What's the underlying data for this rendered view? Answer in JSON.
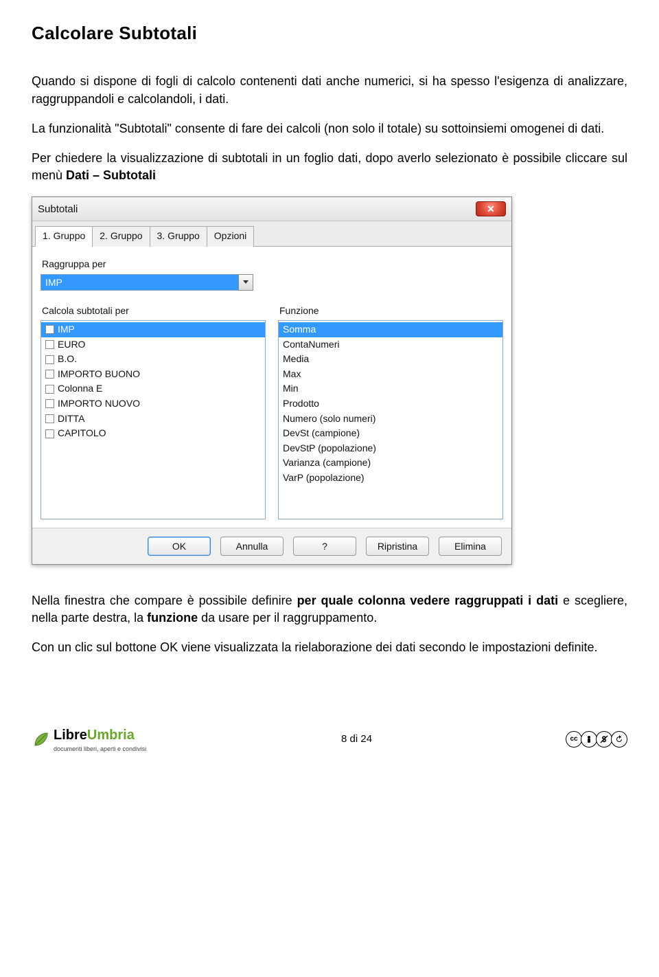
{
  "heading": "Calcolare Subtotali",
  "para1": "Quando si dispone di fogli di calcolo contenenti dati anche numerici, si ha spesso l'esigenza di analizzare, raggruppandoli e calcolandoli, i dati.",
  "para2": "La funzionalità \"Subtotali\" consente di fare dei calcoli (non solo il totale) su sottoinsiemi omogenei di dati.",
  "para3_a": "Per chiedere la visualizzazione di subtotali in un foglio dati, dopo averlo selezionato è possibile cliccare sul menù ",
  "para3_b": "Dati – Subtotali",
  "para4_a": "Nella finestra che compare è possibile definire ",
  "para4_b": "per quale colonna vedere raggruppati i dati",
  "para4_c": " e scegliere, nella parte destra, la ",
  "para4_d": "funzione",
  "para4_e": " da usare per il raggruppamento.",
  "para5": "Con un clic sul bottone OK viene visualizzata la rielaborazione dei dati secondo le impostazioni definite.",
  "dialog": {
    "title": "Subtotali",
    "tabs": [
      "1. Gruppo",
      "2. Gruppo",
      "3. Gruppo",
      "Opzioni"
    ],
    "active_tab": 0,
    "group_by_label": "Raggruppa per",
    "group_by_value": "IMP",
    "calc_label": "Calcola subtotali per",
    "calc_items": [
      "IMP",
      "EURO",
      "B.O.",
      "IMPORTO BUONO",
      "Colonna E",
      "IMPORTO NUOVO",
      "DITTA",
      "CAPITOLO"
    ],
    "calc_selected_index": 0,
    "func_label": "Funzione",
    "func_items": [
      "Somma",
      "ContaNumeri",
      "Media",
      "Max",
      "Min",
      "Prodotto",
      "Numero (solo numeri)",
      "DevSt (campione)",
      "DevStP (popolazione)",
      "Varianza (campione)",
      "VarP (popolazione)"
    ],
    "func_selected_index": 0,
    "buttons": {
      "ok": "OK",
      "cancel": "Annulla",
      "help": "?",
      "reset": "Ripristina",
      "delete": "Elimina"
    }
  },
  "footer": {
    "libre_main_a": "Libre",
    "libre_main_b": "Umbria",
    "libre_sub": "documenti liberi, aperti e condivisi",
    "page": "8 di 24",
    "cc": [
      "cc",
      "BY",
      "$",
      "SA"
    ]
  }
}
